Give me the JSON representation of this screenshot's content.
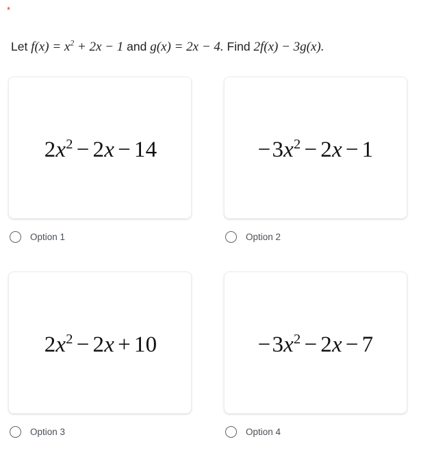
{
  "form": {
    "required_marker": "*",
    "question": {
      "lead": "Let",
      "f_def": "f(x) = x",
      "f_exp": "2",
      "f_rest": "+ 2x − 1",
      "conj": "and",
      "g_def": "g(x) = 2x − 4.",
      "find": "Find",
      "find_expr": "2f(x) − 3g(x)."
    },
    "options": [
      {
        "id": "option-1",
        "label": "Option 1",
        "expression_text": "2x² − 2x − 14",
        "expr": {
          "lead_op": "",
          "coef": "2",
          "var": "x",
          "exp": "2",
          "op1": "−",
          "term2": "2",
          "var2": "x",
          "op2": "−",
          "constant": "14"
        },
        "selected": false
      },
      {
        "id": "option-2",
        "label": "Option 2",
        "expression_text": "−3x² − 2x − 1",
        "expr": {
          "lead_op": "−",
          "coef": "3",
          "var": "x",
          "exp": "2",
          "op1": "−",
          "term2": "2",
          "var2": "x",
          "op2": "−",
          "constant": "1"
        },
        "selected": false
      },
      {
        "id": "option-3",
        "label": "Option 3",
        "expression_text": "2x² − 2x + 10",
        "expr": {
          "lead_op": "",
          "coef": "2",
          "var": "x",
          "exp": "2",
          "op1": "−",
          "term2": "2",
          "var2": "x",
          "op2": "+",
          "constant": "10"
        },
        "selected": false
      },
      {
        "id": "option-4",
        "label": "Option 4",
        "expression_text": "−3x² − 2x − 7",
        "expr": {
          "lead_op": "−",
          "coef": "3",
          "var": "x",
          "exp": "2",
          "op1": "−",
          "term2": "2",
          "var2": "x",
          "op2": "−",
          "constant": "7"
        },
        "selected": false
      }
    ]
  },
  "colors": {
    "required": "#d93025",
    "text": "#202124",
    "label": "#4a4f55",
    "radio_border": "#5f6368",
    "card_border": "#ececec",
    "background": "#ffffff"
  }
}
